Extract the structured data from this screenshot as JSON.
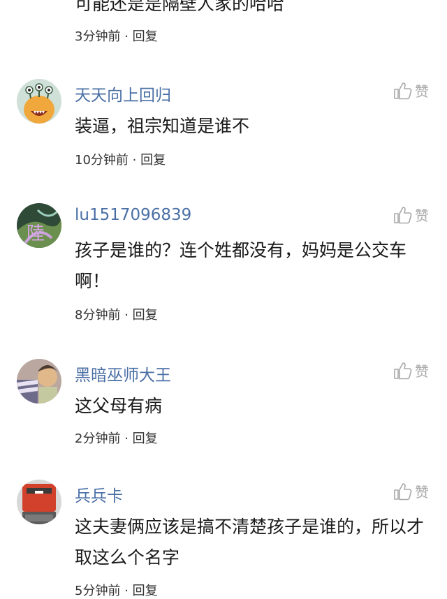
{
  "partial_comment": {
    "text": "可能还是是隔壁人家的哈哈",
    "time": "3分钟前",
    "sep": "·",
    "reply": "回复"
  },
  "comments": [
    {
      "username": "天天向上回归",
      "text": "装逼，祖宗知道是谁不",
      "time": "10分钟前",
      "sep": "·",
      "reply": "回复",
      "like_label": "赞"
    },
    {
      "username": "lu1517096839",
      "text": "孩子是谁的？连个姓都没有，妈妈是公交车啊！",
      "time": "8分钟前",
      "sep": "·",
      "reply": "回复",
      "like_label": "赞"
    },
    {
      "username": "黑暗巫师大王",
      "text": "这父母有病",
      "time": "2分钟前",
      "sep": "·",
      "reply": "回复",
      "like_label": "赞"
    },
    {
      "username": "兵兵卡",
      "text": "这夫妻俩应该是搞不清楚孩子是谁的，所以才取这么个名字",
      "time": "5分钟前",
      "sep": "·",
      "reply": "回复",
      "like_label": "赞"
    }
  ],
  "colors": {
    "username": "#4a6fa5",
    "like": "#a8a8a8",
    "text": "#1a1a1a"
  },
  "icons": {
    "like": "thumbs-up-icon"
  }
}
